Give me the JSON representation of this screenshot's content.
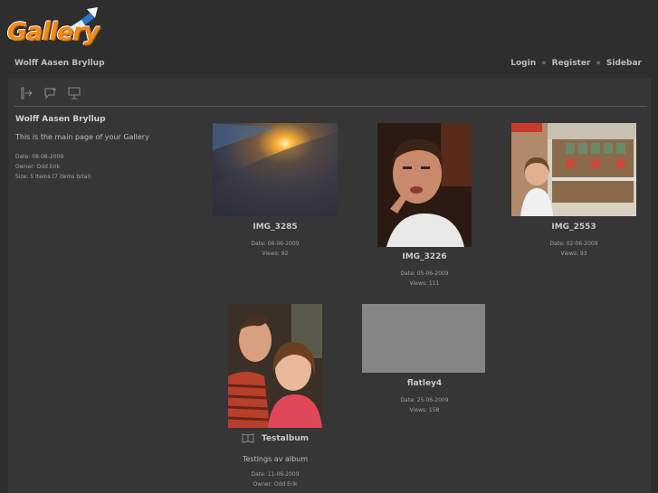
{
  "header": {
    "logo_text": "Gallery",
    "title": "Wolff Aasen Bryllup",
    "nav": [
      "Login",
      "Register",
      "Sidebar"
    ],
    "nav_separator": "«"
  },
  "toolbar": {
    "icons": [
      "view-slideshow-icon",
      "add-comment-icon",
      "presentation-icon"
    ]
  },
  "sidebar": {
    "title": "Wolff Aasen Bryllup",
    "description": "This is the main page of your Gallery",
    "date": "Date: 08-06-2009",
    "owner": "Owner: Odd Erik",
    "size": "Size: 5 Items (7 items total)"
  },
  "items": [
    {
      "name": "IMG_3285",
      "date": "Date: 06-06-2009",
      "views": "Views: 92"
    },
    {
      "name": "IMG_3226",
      "date": "Date: 05-06-2009",
      "views": "Views: 111"
    },
    {
      "name": "IMG_2553",
      "date": "Date: 02-06-2009",
      "views": "Views: 93"
    },
    {
      "name": "Testalbum",
      "description": "Testings av album",
      "date": "Date: 11-06-2009",
      "owner": "Owner: Odd Erik"
    },
    {
      "name": "flatley4",
      "date": "Date: 25-06-2009",
      "views": "Views: 158"
    }
  ],
  "colors": {
    "background": "#2e2e2e",
    "panel": "#363636",
    "logo_orange": "#f08a1c",
    "placeholder_gray": "#858585"
  }
}
